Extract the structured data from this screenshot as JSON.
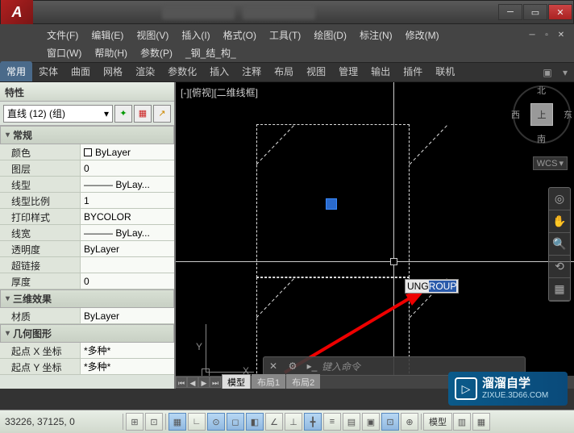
{
  "app": {
    "logo": "A"
  },
  "menu": {
    "row1": [
      "文件(F)",
      "编辑(E)",
      "视图(V)",
      "插入(I)",
      "格式(O)",
      "工具(T)",
      "绘图(D)",
      "标注(N)",
      "修改(M)"
    ],
    "row2": [
      "窗口(W)",
      "帮助(H)",
      "参数(P)",
      "_钢_结_构_"
    ]
  },
  "ribbon": {
    "tabs": [
      "常用",
      "实体",
      "曲面",
      "网格",
      "渲染",
      "参数化",
      "插入",
      "注释",
      "布局",
      "视图",
      "管理",
      "输出",
      "插件",
      "联机"
    ]
  },
  "props": {
    "title": "特性",
    "selection": "直线 (12) (组)",
    "sections": {
      "general": {
        "title": "常规",
        "rows": [
          {
            "label": "颜色",
            "value": "ByLayer",
            "swatch": true
          },
          {
            "label": "图层",
            "value": "0"
          },
          {
            "label": "线型",
            "value": "——— ByLay...",
            "line": true
          },
          {
            "label": "线型比例",
            "value": "1"
          },
          {
            "label": "打印样式",
            "value": "BYCOLOR"
          },
          {
            "label": "线宽",
            "value": "——— ByLay...",
            "line": true
          },
          {
            "label": "透明度",
            "value": "ByLayer"
          },
          {
            "label": "超链接",
            "value": ""
          },
          {
            "label": "厚度",
            "value": "0"
          }
        ]
      },
      "threeD": {
        "title": "三维效果",
        "rows": [
          {
            "label": "材质",
            "value": "ByLayer"
          }
        ]
      },
      "geometry": {
        "title": "几何图形",
        "rows": [
          {
            "label": "起点 X 坐标",
            "value": "*多种*"
          },
          {
            "label": "起点 Y 坐标",
            "value": "*多种*"
          }
        ]
      }
    }
  },
  "viewport": {
    "label_prefix": "[-][俯视][二维线框]",
    "cmd_text": "UNG",
    "cmd_sel": "ROUP",
    "viewcube": {
      "n": "北",
      "s": "南",
      "w": "西",
      "e": "东",
      "face": "上"
    },
    "wcs": "WCS",
    "ucs": {
      "x": "X",
      "y": "Y"
    }
  },
  "layout_tabs": [
    "模型",
    "布局1",
    "布局2"
  ],
  "cmdline": {
    "placeholder": "键入命令"
  },
  "status": {
    "coords": "33226, 37125, 0",
    "model_btn": "模型"
  },
  "watermark": {
    "title": "溜溜自学",
    "sub": "ZIXUE.3D66.COM"
  }
}
